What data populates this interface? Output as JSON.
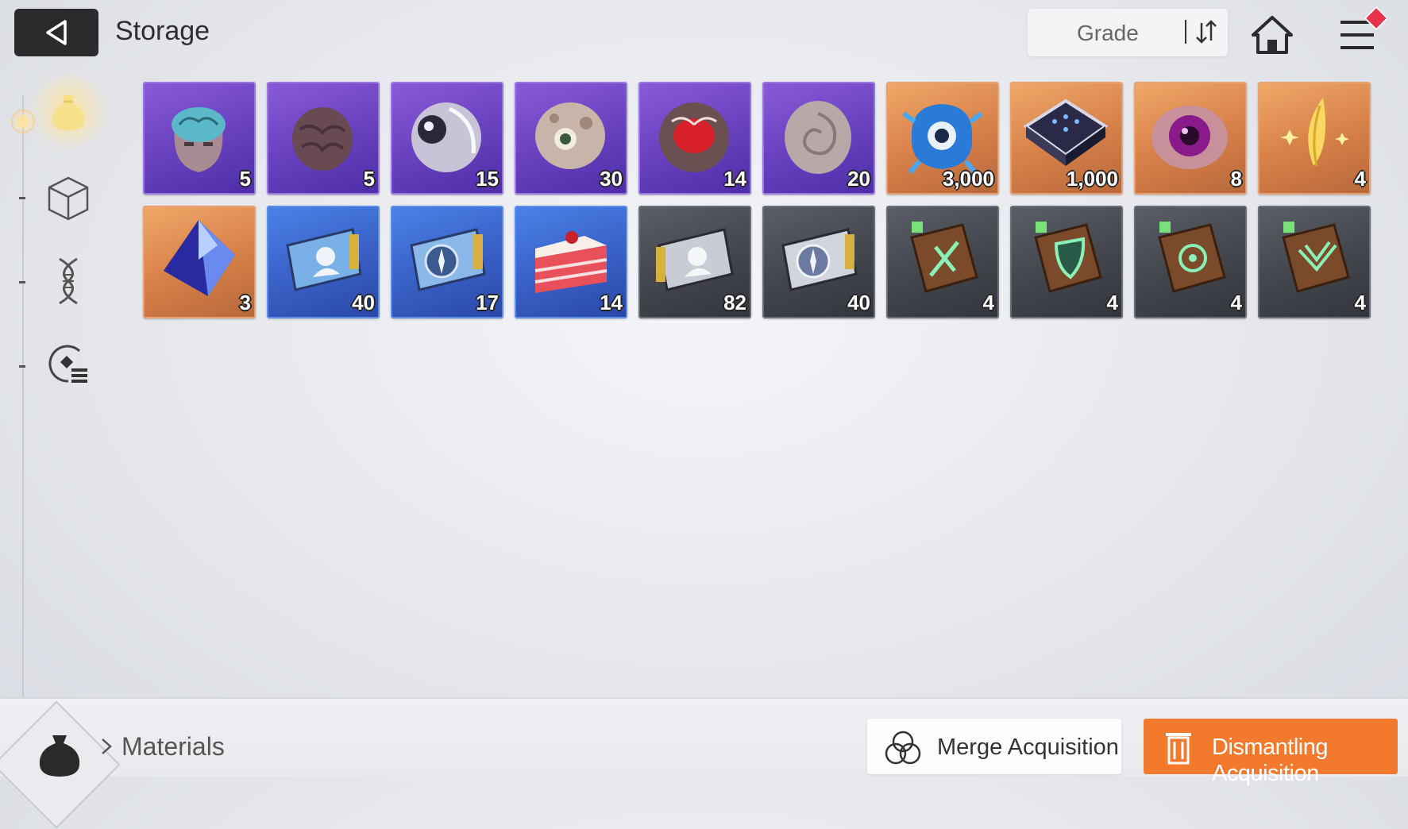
{
  "header": {
    "title": "Storage",
    "sort_label": "Grade"
  },
  "sidebar": {
    "tabs": [
      {
        "name": "materials",
        "icon": "pouch-icon",
        "active": true
      },
      {
        "name": "cube",
        "icon": "cube-icon",
        "active": false
      },
      {
        "name": "dna",
        "icon": "dna-icon",
        "active": false
      },
      {
        "name": "skill",
        "icon": "skill-list-icon",
        "active": false
      }
    ]
  },
  "items": [
    {
      "id": "item-1",
      "grade": "purple",
      "icon": "brain-head-icon",
      "qty": "5"
    },
    {
      "id": "item-2",
      "grade": "purple",
      "icon": "brain-icon",
      "qty": "5"
    },
    {
      "id": "item-3",
      "grade": "purple",
      "icon": "silver-orb-icon",
      "qty": "15"
    },
    {
      "id": "item-4",
      "grade": "purple",
      "icon": "flesh-eye-icon",
      "qty": "30"
    },
    {
      "id": "item-5",
      "grade": "purple",
      "icon": "red-core-icon",
      "qty": "14"
    },
    {
      "id": "item-6",
      "grade": "purple",
      "icon": "spiral-shell-icon",
      "qty": "20"
    },
    {
      "id": "item-7",
      "grade": "orange",
      "icon": "blue-eye-creature-icon",
      "qty": "3,000"
    },
    {
      "id": "item-8",
      "grade": "orange",
      "icon": "chip-icon",
      "qty": "1,000"
    },
    {
      "id": "item-9",
      "grade": "orange",
      "icon": "purple-eye-icon",
      "qty": "8"
    },
    {
      "id": "item-10",
      "grade": "orange",
      "icon": "golden-feather-icon",
      "qty": "4"
    },
    {
      "id": "item-11",
      "grade": "orange",
      "icon": "blue-crystal-icon",
      "qty": "3"
    },
    {
      "id": "item-12",
      "grade": "blue",
      "icon": "id-card-icon",
      "qty": "40"
    },
    {
      "id": "item-13",
      "grade": "blue",
      "icon": "compass-ticket-icon",
      "qty": "17"
    },
    {
      "id": "item-14",
      "grade": "blue",
      "icon": "cake-icon",
      "qty": "14"
    },
    {
      "id": "item-15",
      "grade": "gray",
      "icon": "id-card-icon",
      "qty": "82"
    },
    {
      "id": "item-16",
      "grade": "gray",
      "icon": "compass-ticket-icon",
      "qty": "40"
    },
    {
      "id": "item-17",
      "grade": "gray",
      "icon": "sword-book-icon",
      "qty": "4"
    },
    {
      "id": "item-18",
      "grade": "gray",
      "icon": "shield-book-icon",
      "qty": "4"
    },
    {
      "id": "item-19",
      "grade": "gray",
      "icon": "target-book-icon",
      "qty": "4"
    },
    {
      "id": "item-20",
      "grade": "gray",
      "icon": "wings-book-icon",
      "qty": "4"
    }
  ],
  "footer": {
    "category_label": "Materials",
    "merge_label": "Merge Acquisition",
    "dismantle_label": "Dismantling Acquisition"
  },
  "colors": {
    "purple": "#6a42c0",
    "orange": "#d8824a",
    "blue": "#3a62c8",
    "gray": "#44474e",
    "accent": "#f37a2c",
    "badge": "#e8324a"
  }
}
